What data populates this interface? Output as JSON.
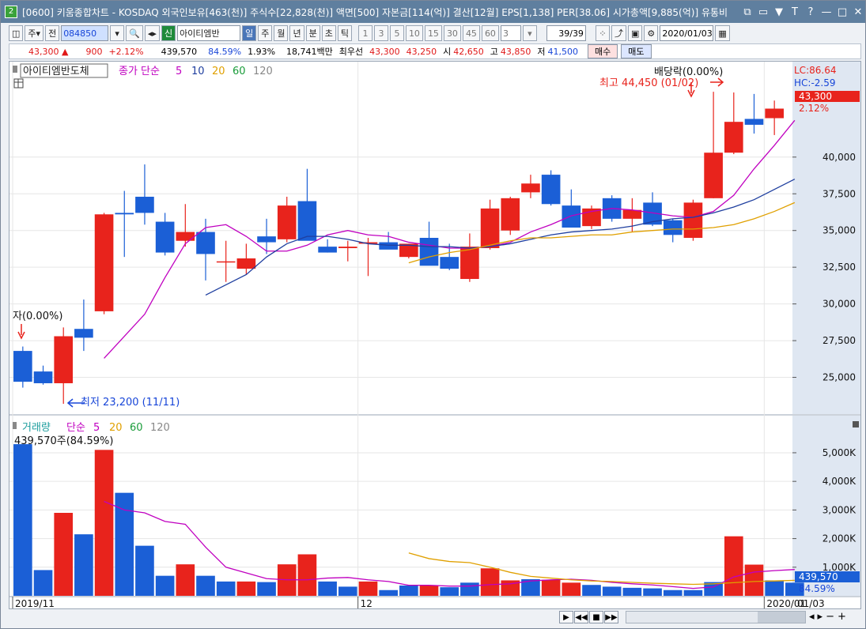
{
  "window": {
    "badge": "2",
    "title": "[0600] 키움종합차트 - KOSDAQ 외국인보유[463(천)] 주식수[22,828(천)] 액면[500] 자본금[114(억)] 결산[12월] EPS[1,138] PER[38.06] 시가총액[9,885(억)] 유통비",
    "buttons": [
      "⧉",
      "▭",
      "▼",
      "T",
      "?",
      "—",
      "□",
      "✕"
    ]
  },
  "toolbar1": {
    "btn1": "주",
    "btn2": "전",
    "code": "084850",
    "stock_badge": "신",
    "stock_name": "아이티엠반",
    "period_tabs": [
      "일",
      "주",
      "월",
      "년",
      "분",
      "초",
      "틱"
    ],
    "period_selected": "일",
    "intervals": [
      "1",
      "3",
      "5",
      "10",
      "15",
      "30",
      "45",
      "60"
    ],
    "interval_value": "3",
    "count": "39/39",
    "date": "2020/01/03"
  },
  "toolbar2": {
    "price": "43,300 ▲",
    "change": "900",
    "change_pct": "+2.12%",
    "volume": "439,570",
    "vol_ratio": "84.59%",
    "turnover": "1.93%",
    "amount": "18,741백만",
    "best_label": "최우선",
    "best_ask": "43,300",
    "best_bid": "43,250",
    "open_label": "시",
    "open": "42,650",
    "high_label": "고",
    "high": "43,850",
    "low_label": "저",
    "low": "41,500",
    "buy": "매수",
    "sell": "매도"
  },
  "price_panel": {
    "stock_label": "아이티엠반도체",
    "ma_title": "종가 단순",
    "ma_periods": [
      "5",
      "10",
      "20",
      "60",
      "120"
    ],
    "y_ticks": [
      "40,000",
      "37,500",
      "35,000",
      "32,500",
      "30,000",
      "27,500",
      "25,000"
    ],
    "lc": "LC:86.64",
    "hc": "HC:-2.59",
    "current_price": "43,300",
    "current_pct": "2.12%",
    "low_annot": "최저 23,200 (11/11)",
    "high_annot": "최고 44,450 (01/02)",
    "div_annot_left": "자(0.00%)",
    "div_annot_right": "배당락(0.00%)"
  },
  "volume_panel": {
    "title": "거래량",
    "ma_title": "단순",
    "ma_periods": [
      "5",
      "20",
      "60",
      "120"
    ],
    "vol_info": "439,570주(84.59%)",
    "y_ticks": [
      "5,000K",
      "4,000K",
      "3,000K",
      "2,000K",
      "1,000K"
    ],
    "current_vol": "439,570",
    "current_pct": "84.59%"
  },
  "x_axis": {
    "labels": [
      "2019/11",
      "12",
      "2020/01"
    ],
    "right_label": "01/03"
  },
  "chart_data": {
    "type": "candlestick",
    "y_price_range": [
      22500,
      46500
    ],
    "y_volume_range": [
      0,
      5800
    ],
    "up_color": "#e8231c",
    "down_color": "#1b5fd6",
    "candles": [
      {
        "o": 26800,
        "h": 27100,
        "l": 24300,
        "c": 24700
      },
      {
        "o": 25400,
        "h": 25800,
        "l": 24500,
        "c": 24600
      },
      {
        "o": 24600,
        "h": 28400,
        "l": 23200,
        "c": 27800
      },
      {
        "o": 28300,
        "h": 30300,
        "l": 26800,
        "c": 27700
      },
      {
        "o": 29500,
        "h": 36200,
        "l": 29300,
        "c": 36100
      },
      {
        "o": 36200,
        "h": 37700,
        "l": 33200,
        "c": 36100
      },
      {
        "o": 37300,
        "h": 39500,
        "l": 35400,
        "c": 36200
      },
      {
        "o": 35600,
        "h": 36200,
        "l": 33300,
        "c": 33500
      },
      {
        "o": 34300,
        "h": 36800,
        "l": 33900,
        "c": 34900
      },
      {
        "o": 34900,
        "h": 35800,
        "l": 31600,
        "c": 33400
      },
      {
        "o": 32900,
        "h": 34300,
        "l": 31500,
        "c": 32900
      },
      {
        "o": 32400,
        "h": 34100,
        "l": 32000,
        "c": 33100
      },
      {
        "o": 34600,
        "h": 35800,
        "l": 33400,
        "c": 34200
      },
      {
        "o": 34400,
        "h": 37300,
        "l": 34200,
        "c": 36700
      },
      {
        "o": 37000,
        "h": 39200,
        "l": 34400,
        "c": 34300
      },
      {
        "o": 33900,
        "h": 34400,
        "l": 33500,
        "c": 33500
      },
      {
        "o": 33800,
        "h": 34300,
        "l": 32900,
        "c": 33900
      },
      {
        "o": 34100,
        "h": 34500,
        "l": 31900,
        "c": 34200
      },
      {
        "o": 34200,
        "h": 34900,
        "l": 33800,
        "c": 33700
      },
      {
        "o": 33200,
        "h": 34100,
        "l": 33100,
        "c": 34100
      },
      {
        "o": 34500,
        "h": 35600,
        "l": 32700,
        "c": 32600
      },
      {
        "o": 33200,
        "h": 34100,
        "l": 32300,
        "c": 32400
      },
      {
        "o": 31700,
        "h": 34800,
        "l": 31500,
        "c": 33900
      },
      {
        "o": 33800,
        "h": 37100,
        "l": 33700,
        "c": 36500
      },
      {
        "o": 35000,
        "h": 37300,
        "l": 34700,
        "c": 37200
      },
      {
        "o": 37600,
        "h": 38800,
        "l": 37200,
        "c": 38200
      },
      {
        "o": 38800,
        "h": 39100,
        "l": 36700,
        "c": 36800
      },
      {
        "o": 36700,
        "h": 37800,
        "l": 35500,
        "c": 35200
      },
      {
        "o": 35300,
        "h": 36700,
        "l": 35100,
        "c": 36500
      },
      {
        "o": 37200,
        "h": 37400,
        "l": 35600,
        "c": 35800
      },
      {
        "o": 35800,
        "h": 37200,
        "l": 34900,
        "c": 36400
      },
      {
        "o": 36900,
        "h": 37600,
        "l": 35300,
        "c": 35400
      },
      {
        "o": 35700,
        "h": 35800,
        "l": 34200,
        "c": 34700
      },
      {
        "o": 34500,
        "h": 37100,
        "l": 34300,
        "c": 36900
      },
      {
        "o": 37200,
        "h": 44450,
        "l": 37200,
        "c": 40300
      },
      {
        "o": 40300,
        "h": 44400,
        "l": 40200,
        "c": 42400
      },
      {
        "o": 42600,
        "h": 44300,
        "l": 41600,
        "c": 42200
      },
      {
        "o": 42650,
        "h": 43850,
        "l": 41500,
        "c": 43300
      }
    ],
    "volumes": [
      5300,
      900,
      2900,
      2150,
      5100,
      3600,
      1750,
      700,
      1100,
      700,
      500,
      500,
      480,
      1100,
      1450,
      500,
      320,
      500,
      200,
      360,
      360,
      300,
      460,
      960,
      540,
      580,
      560,
      460,
      380,
      320,
      280,
      260,
      200,
      200,
      480,
      2080,
      1090,
      540,
      460
    ],
    "volume_up": [
      false,
      false,
      true,
      false,
      true,
      false,
      false,
      false,
      true,
      false,
      false,
      true,
      false,
      true,
      true,
      false,
      false,
      true,
      false,
      false,
      true,
      false,
      false,
      true,
      true,
      false,
      true,
      true,
      false,
      false,
      false,
      false,
      false,
      false,
      false,
      true,
      true,
      false,
      false
    ],
    "ma5": [
      null,
      null,
      null,
      null,
      26300,
      27800,
      29300,
      31800,
      34100,
      35200,
      35400,
      34600,
      33600,
      33600,
      34000,
      34700,
      35000,
      34700,
      34600,
      34200,
      34000,
      33800,
      33800,
      33900,
      34200,
      34900,
      35400,
      36000,
      36300,
      36500,
      36400,
      36200,
      36000,
      35900,
      36300,
      37400,
      39200,
      40800,
      42500
    ],
    "ma10": [
      null,
      null,
      null,
      null,
      null,
      null,
      null,
      null,
      null,
      30600,
      31300,
      32000,
      33200,
      34100,
      34600,
      34600,
      34400,
      34100,
      34000,
      34000,
      33900,
      33900,
      33800,
      33900,
      34100,
      34400,
      34700,
      34900,
      35000,
      35100,
      35300,
      35600,
      35800,
      35900,
      36200,
      36600,
      37100,
      37800,
      38500
    ],
    "ma20": [
      null,
      null,
      null,
      null,
      null,
      null,
      null,
      null,
      null,
      null,
      null,
      null,
      null,
      null,
      null,
      null,
      null,
      null,
      null,
      32800,
      33200,
      33500,
      33700,
      34000,
      34300,
      34500,
      34500,
      34600,
      34700,
      34700,
      34900,
      35000,
      35100,
      35100,
      35200,
      35400,
      35800,
      36300,
      36900
    ],
    "vma5": [
      null,
      null,
      null,
      null,
      3300,
      3000,
      2900,
      2600,
      2500,
      1700,
      1000,
      800,
      600,
      560,
      560,
      620,
      640,
      560,
      500,
      370,
      370,
      340,
      340,
      390,
      420,
      520,
      560,
      580,
      540,
      470,
      420,
      380,
      320,
      260,
      310,
      660,
      830,
      880,
      920
    ],
    "vma20": [
      null,
      null,
      null,
      null,
      null,
      null,
      null,
      null,
      null,
      null,
      null,
      null,
      null,
      null,
      null,
      null,
      null,
      null,
      null,
      1500,
      1300,
      1200,
      1160,
      1000,
      820,
      680,
      620,
      560,
      520,
      500,
      470,
      440,
      420,
      400,
      420,
      460,
      500,
      520,
      540
    ],
    "x_tick_indices": [
      0,
      17,
      37
    ]
  }
}
